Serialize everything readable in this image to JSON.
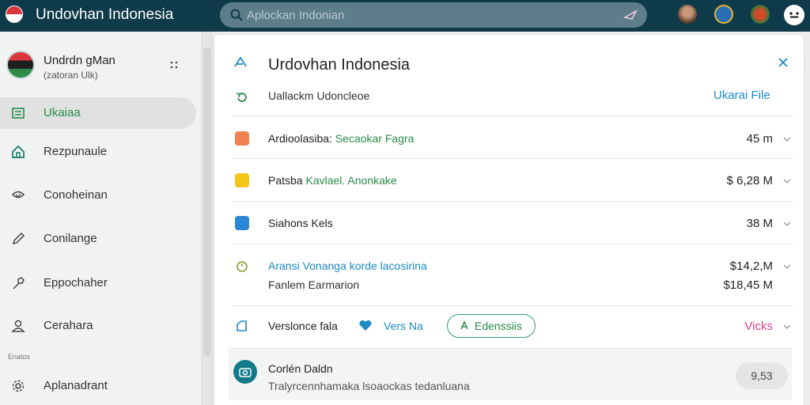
{
  "app": {
    "title": "Undovhan Indonesia"
  },
  "search": {
    "placeholder": "Aplockan Indonian"
  },
  "sidebar": {
    "profile": {
      "name": "Undrdn gMan",
      "subtitle": "(zatoran Ulk)",
      "menu_icon": "dots-icon"
    },
    "items": [
      {
        "label": "Ukaiaa",
        "icon": "list-icon",
        "active": true
      },
      {
        "label": "Rezpunaule",
        "icon": "house-icon",
        "active": false
      },
      {
        "label": "Conoheinan",
        "icon": "shield-icon",
        "active": false
      },
      {
        "label": "Conilange",
        "icon": "pencil-icon",
        "active": false
      },
      {
        "label": "Eppochaher",
        "icon": "hammer-icon",
        "active": false
      },
      {
        "label": "Cerahara",
        "icon": "person-icon",
        "active": false
      }
    ],
    "section_label": "Enatos",
    "bottom_item": {
      "label": "Aplanadrant",
      "icon": "gear-icon"
    }
  },
  "panel": {
    "title": "Urdovhan Indonesia",
    "subheader": {
      "label": "Uallackm Udoncleoe",
      "link": "Ukarai File"
    },
    "rows": [
      {
        "icon": "orange-badge-icon",
        "prefix": "Ardioolasiba: ",
        "highlight": "Secaokar Fagra",
        "value": "45 m"
      },
      {
        "icon": "yellow-badge-icon",
        "prefix": "Patsba ",
        "highlight": "Kavlael. Anonkake",
        "value": "$ 6,28 M"
      },
      {
        "icon": "blue-badge-icon",
        "prefix": "Siahons Kels",
        "highlight": "",
        "value": "38 M"
      },
      {
        "icon": "timer-icon",
        "line1": "Aransi Vonanga korde lacosirina",
        "line2": "Fanlem Earmarion",
        "value1": "$14,2,M",
        "value2": "$18,45 M"
      }
    ],
    "version_row": {
      "label": "Verslonce fala",
      "tag_label": "Vers Na",
      "pill_label": "Edenssiis",
      "value": "Vicks",
      "colors": {
        "tag": "#1c8ac5",
        "pill": "#2a8a4a",
        "value": "#d6408a"
      }
    },
    "footer": {
      "title": "Corlén Daldn",
      "subtitle": "Tralyrcennhamaka lsoaockas tedanluana",
      "badge": "9,53"
    }
  },
  "colors": {
    "topbar": "#0f3a4a",
    "accent_green": "#2a8a4a",
    "accent_blue": "#1c8ac5",
    "accent_pink": "#d6408a"
  }
}
